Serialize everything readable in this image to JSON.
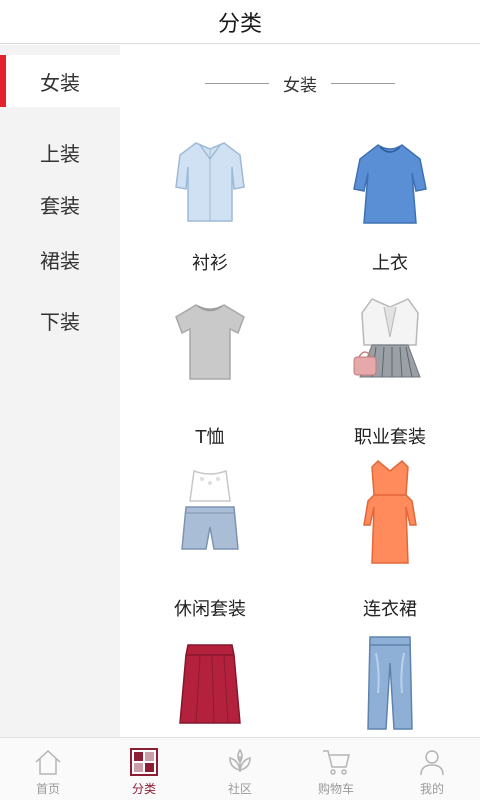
{
  "header": {
    "title": "分类"
  },
  "sidebar": {
    "items": [
      {
        "label": "女装",
        "active": true
      },
      {
        "label": "上装",
        "active": false
      },
      {
        "label": "套装",
        "active": false
      },
      {
        "label": "裙装",
        "active": false
      },
      {
        "label": "下装",
        "active": false
      }
    ]
  },
  "section": {
    "title": "女装"
  },
  "products": [
    {
      "label": "衬衫",
      "icon": "shirt-image"
    },
    {
      "label": "上衣",
      "icon": "blue-top-image"
    },
    {
      "label": "T恤",
      "icon": "tshirt-image"
    },
    {
      "label": "职业套装",
      "icon": "business-suit-image"
    },
    {
      "label": "休闲套装",
      "icon": "casual-set-image"
    },
    {
      "label": "连衣裙",
      "icon": "dress-image"
    },
    {
      "label": "",
      "icon": "skirt-image"
    },
    {
      "label": "",
      "icon": "jeans-image"
    }
  ],
  "tabbar": {
    "items": [
      {
        "label": "首页",
        "icon": "home-icon",
        "active": false
      },
      {
        "label": "分类",
        "icon": "category-icon",
        "active": true
      },
      {
        "label": "社区",
        "icon": "community-icon",
        "active": false
      },
      {
        "label": "购物车",
        "icon": "cart-icon",
        "active": false
      },
      {
        "label": "我的",
        "icon": "profile-icon",
        "active": false
      }
    ]
  },
  "colors": {
    "accent": "#e5232d",
    "active_tab": "#8b1e34",
    "sidebar_bg": "#f3f3f3"
  }
}
